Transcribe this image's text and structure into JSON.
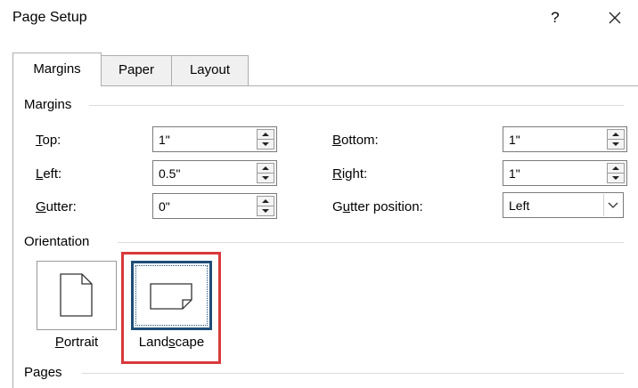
{
  "window": {
    "title": "Page Setup",
    "help_label": "?",
    "close_label": "✕"
  },
  "tabs": [
    {
      "label": "Margins",
      "selected": true
    },
    {
      "label": "Paper",
      "selected": false
    },
    {
      "label": "Layout",
      "selected": false
    }
  ],
  "margins": {
    "group_label": "Margins",
    "top": {
      "label_key": "T",
      "label_rest": "op:",
      "value": "1\""
    },
    "left": {
      "label_key": "L",
      "label_rest": "eft:",
      "value": "0.5\""
    },
    "gutter": {
      "label_key": "G",
      "label_rest": "utter:",
      "value": "0\""
    },
    "bottom": {
      "label_key": "B",
      "label_rest": "ottom:",
      "value": "1\""
    },
    "right": {
      "label_key": "R",
      "label_rest": "ight:",
      "value": "1\""
    },
    "gutter_position": {
      "label_pre": "G",
      "label_key": "u",
      "label_rest": "tter position:",
      "value": "Left"
    }
  },
  "orientation": {
    "group_label": "Orientation",
    "portrait": {
      "label_key": "P",
      "label_rest": "ortrait"
    },
    "landscape": {
      "label_pre": "Land",
      "label_key": "s",
      "label_rest": "cape",
      "selected": true
    }
  },
  "pages": {
    "group_label": "Pages"
  },
  "colors": {
    "selection_border": "#1e4e79",
    "highlight": "#d9393b"
  },
  "icons": [
    "help-icon",
    "close-icon",
    "portrait-page-icon",
    "landscape-page-icon",
    "spin-up-icon",
    "spin-down-icon",
    "chevron-down-icon"
  ]
}
